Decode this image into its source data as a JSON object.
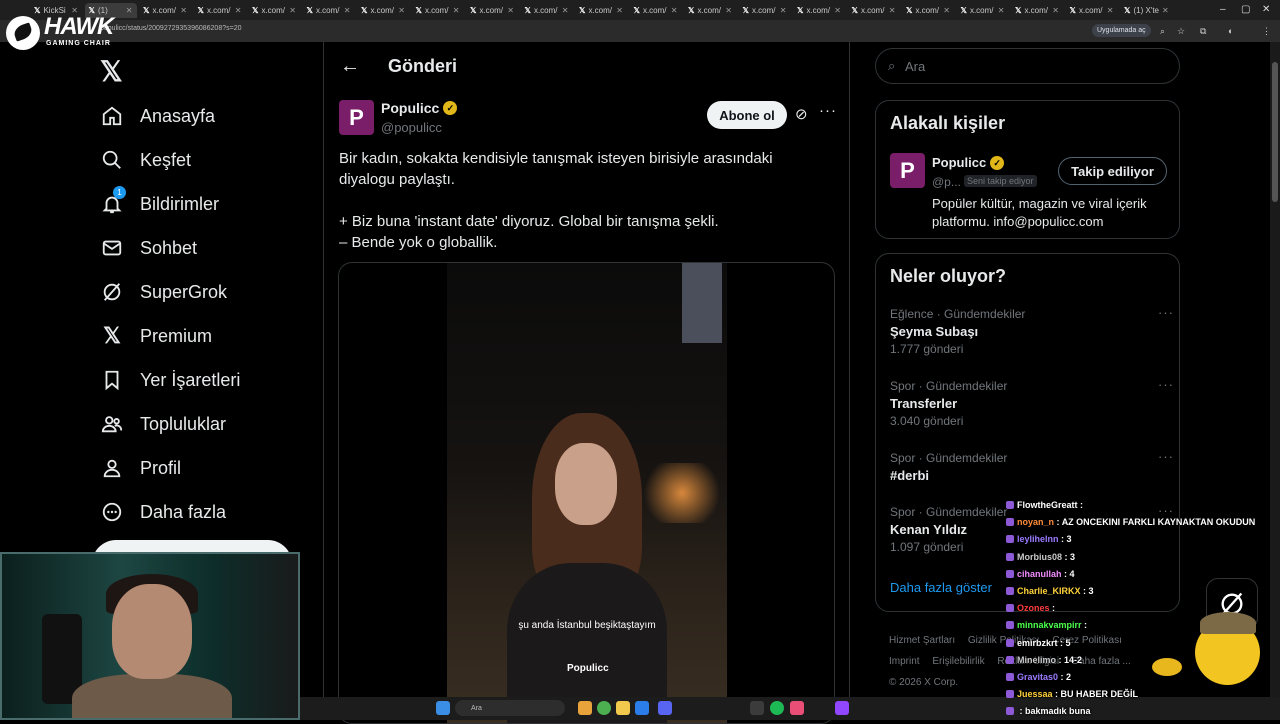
{
  "browser": {
    "tabs": [
      {
        "label": "KickSi"
      },
      {
        "label": "(1)"
      },
      {
        "label": "x.com/"
      },
      {
        "label": "x.com/"
      },
      {
        "label": "x.com/"
      },
      {
        "label": "x.com/"
      },
      {
        "label": "x.com/"
      },
      {
        "label": "x.com/"
      },
      {
        "label": "x.com/"
      },
      {
        "label": "x.com/"
      },
      {
        "label": "x.com/"
      },
      {
        "label": "x.com/"
      },
      {
        "label": "x.com/"
      },
      {
        "label": "x.com/"
      },
      {
        "label": "x.com/"
      },
      {
        "label": "x.com/"
      },
      {
        "label": "x.com/"
      },
      {
        "label": "x.com/"
      },
      {
        "label": "x.com/"
      },
      {
        "label": "x.com/"
      },
      {
        "label": "(1) X'te"
      }
    ],
    "url": "populicc/status/2009272935396086208?s=20",
    "open_in_app": "Uygulamada aç"
  },
  "overlay_logo": {
    "name": "HAWK",
    "subtitle": "GAMING CHAIR"
  },
  "nav": {
    "items": [
      {
        "label": "Anasayfa",
        "icon": "home-icon"
      },
      {
        "label": "Keşfet",
        "icon": "search-icon"
      },
      {
        "label": "Bildirimler",
        "icon": "bell-icon",
        "badge": "1"
      },
      {
        "label": "Sohbet",
        "icon": "mail-icon"
      },
      {
        "label": "SuperGrok",
        "icon": "grok-icon"
      },
      {
        "label": "Premium",
        "icon": "x-icon"
      },
      {
        "label": "Yer İşaretleri",
        "icon": "bookmark-icon"
      },
      {
        "label": "Topluluklar",
        "icon": "communities-icon"
      },
      {
        "label": "Profil",
        "icon": "profile-icon"
      },
      {
        "label": "Daha fazla",
        "icon": "more-circle-icon"
      }
    ]
  },
  "post_header": {
    "title": "Gönderi"
  },
  "post": {
    "author_name": "Populicc",
    "author_handle": "@populicc",
    "subscribe_label": "Abone ol",
    "text_line1": "Bir kadın, sokakta kendisiyle tanışmak isteyen birisiyle arasındaki",
    "text_line2": "diyalogu paylaştı.",
    "text_line3": "+ Biz buna 'instant date' diyoruz. Global bir tanışma şekli.",
    "text_line4": "– Bende yok o globallik.",
    "video_subtitle": "şu anda İstanbul beşiktaştayım",
    "video_watermark": "Populicc"
  },
  "search": {
    "placeholder": "Ara"
  },
  "related": {
    "title": "Alakalı kişiler",
    "name": "Populicc",
    "handle": "@p...",
    "follows_you": "Seni takip ediyor",
    "follow_label": "Takip ediliyor",
    "bio": "Popüler kültür, magazin ve viral içerik platformu. info@populicc.com"
  },
  "trends": {
    "title": "Neler oluyor?",
    "items": [
      {
        "category": "Eğlence · Gündemdekiler",
        "name": "Şeyma Subaşı",
        "count": "1.777 gönderi"
      },
      {
        "category": "Spor · Gündemdekiler",
        "name": "Transferler",
        "count": "3.040 gönderi"
      },
      {
        "category": "Spor · Gündemdekiler",
        "name": "#derbi",
        "count": ""
      },
      {
        "category": "Spor · Gündemdekiler",
        "name": "Kenan Yıldız",
        "count": "1.097 gönderi"
      }
    ],
    "show_more": "Daha fazla göster"
  },
  "footer": {
    "links": [
      "Hizmet Şartları",
      "Gizlilik Politikası",
      "Çerez Politikası",
      "Imprint",
      "Erişilebilirlik",
      "Reklam bilgisi",
      "Daha fazla ..."
    ],
    "copyright": "© 2026 X Corp."
  },
  "chat": {
    "messages": [
      {
        "user": "FlowtheGreatt",
        "text": "",
        "color": "#ffffff"
      },
      {
        "user": "noyan_n",
        "text": "AZ ONCEKINI FARKLI KAYNAKTAN OKUDUN",
        "color": "#ff8c3a"
      },
      {
        "user": "leylihelnn",
        "text": "3",
        "color": "#9b7bff"
      },
      {
        "user": "Morbius08",
        "text": "3",
        "color": "#c9c9c9"
      },
      {
        "user": "cihanullah",
        "text": "4",
        "color": "#f28cff"
      },
      {
        "user": "Charlie_KIRKX",
        "text": "3",
        "color": "#ffd23a"
      },
      {
        "user": "Ozones",
        "text": "",
        "color": "#ff3d3d"
      },
      {
        "user": "minnakvampirr",
        "text": "",
        "color": "#4cff4c"
      },
      {
        "user": "emirbzkrt",
        "text": "5",
        "color": "#ffffff"
      },
      {
        "user": "Minelimo",
        "text": "14-2",
        "color": "#c9c9c9"
      },
      {
        "user": "Gravitas0",
        "text": "2",
        "color": "#9b7bff"
      },
      {
        "user": "Juessaa",
        "text": "BU HABER DEĞİL",
        "color": "#ffd23a"
      },
      {
        "user": "",
        "text": "bakmadık buna",
        "color": "#ffffff"
      }
    ]
  },
  "taskbar": {
    "search_placeholder": "Ara"
  },
  "colors": {
    "accent": "#1d9bf0",
    "brand": "#7a1e6a",
    "verified": "#e2b719"
  }
}
